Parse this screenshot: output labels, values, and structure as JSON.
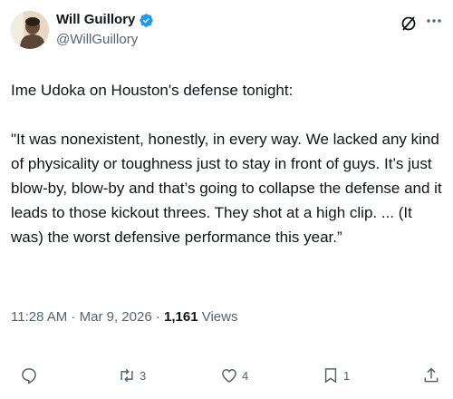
{
  "author": {
    "display_name": "Will Guillory",
    "handle": "@WillGuillory"
  },
  "tweet": {
    "text": "Ime Udoka on Houston's defense tonight:\n\n\"It was nonexistent, honestly, in every way. We lacked any kind of physicality or toughness just to stay in front of guys. It’s just blow-by, blow-by and that’s going to collapse the defense and it leads to those kickout threes. They shot at a high clip. ... (It was) the worst defensive performance this year.”"
  },
  "meta": {
    "time": "11:28 AM",
    "separator": " · ",
    "date": "Mar 9, 2026",
    "views_count": "1,161",
    "views_label": " Views"
  },
  "actions": {
    "reply_count": "",
    "retweet_count": "3",
    "like_count": "4",
    "bookmark_count": "1"
  },
  "colors": {
    "verified": "#1d9bf0",
    "text": "#0f1419",
    "secondary": "#536471"
  },
  "icons": [
    "verified-icon",
    "grok-icon",
    "more-icon",
    "reply-icon",
    "retweet-icon",
    "like-icon",
    "bookmark-icon",
    "share-icon"
  ]
}
